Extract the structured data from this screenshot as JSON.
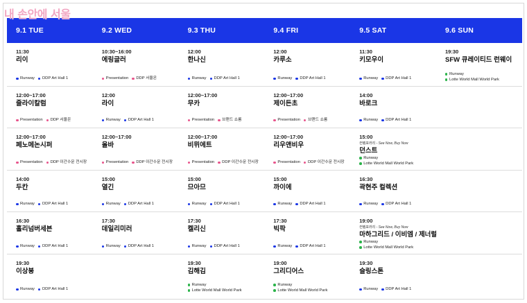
{
  "logo": {
    "text": "내 손안에 서울"
  },
  "colors": {
    "header_bg": "#1a36e6",
    "dot_runway": "#1a36e6",
    "dot_venue": "#1a36e6",
    "dot_presentation": "#e8548c",
    "dot_outdoor": "#2bb34a",
    "logo": "#f2a6c2"
  },
  "days": [
    {
      "label": "9.1 TUE"
    },
    {
      "label": "9.2 WED"
    },
    {
      "label": "9.3 THU"
    },
    {
      "label": "9.4 FRI"
    },
    {
      "label": "9.5 SAT"
    },
    {
      "label": "9.6 SUN"
    }
  ],
  "rows": [
    [
      {
        "time": "11:30",
        "title": "리이",
        "tags": [
          {
            "label": "Runway",
            "kind": "runway"
          },
          {
            "label": "DDP Art Hall 1",
            "kind": "venue"
          }
        ]
      },
      {
        "time": "10:30~16:00",
        "title": "에링글러",
        "tags": [
          {
            "label": "Presentation",
            "kind": "presentation"
          },
          {
            "label": "DDP 서울온",
            "kind": "presentation"
          }
        ]
      },
      {
        "time": "12:00",
        "title": "한나신",
        "tags": [
          {
            "label": "Runway",
            "kind": "runway"
          },
          {
            "label": "DDP Art Hall 1",
            "kind": "venue"
          }
        ]
      },
      {
        "time": "12:00",
        "title": "카루소",
        "tags": [
          {
            "label": "Runway",
            "kind": "runway"
          },
          {
            "label": "DDP Art Hall 1",
            "kind": "venue"
          }
        ]
      },
      {
        "time": "11:30",
        "title": "키모우이",
        "tags": [
          {
            "label": "Runway",
            "kind": "runway"
          },
          {
            "label": "DDP Art Hall 1",
            "kind": "venue"
          }
        ]
      },
      {
        "time": "19:30",
        "title": "SFW 큐레이티드 런웨이",
        "stack": true,
        "tags": [
          {
            "label": "Runway",
            "kind": "outdoor"
          },
          {
            "label": "Lotte World Mall World Park",
            "kind": "outdoor"
          }
        ]
      }
    ],
    [
      {
        "time": "12:00~17:00",
        "title": "줄라이칼럼",
        "tags": [
          {
            "label": "Presentation",
            "kind": "presentation"
          },
          {
            "label": "DDP 서울온",
            "kind": "presentation"
          }
        ]
      },
      {
        "time": "12:00",
        "title": "라이",
        "tags": [
          {
            "label": "Runway",
            "kind": "runway"
          },
          {
            "label": "DDP Art Hall 1",
            "kind": "venue"
          }
        ]
      },
      {
        "time": "12:00~17:00",
        "title": "무카",
        "tags": [
          {
            "label": "Presentation",
            "kind": "presentation"
          },
          {
            "label": "브랜드 쇼룸",
            "kind": "presentation"
          }
        ]
      },
      {
        "time": "12:00~17:00",
        "title": "제이든초",
        "tags": [
          {
            "label": "Presentation",
            "kind": "presentation"
          },
          {
            "label": "브랜드 쇼룸",
            "kind": "presentation"
          }
        ]
      },
      {
        "time": "14:00",
        "title": "바로크",
        "tags": [
          {
            "label": "Runway",
            "kind": "runway"
          },
          {
            "label": "DDP Art Hall 1",
            "kind": "venue"
          }
        ]
      },
      {
        "empty": true
      }
    ],
    [
      {
        "time": "12:00~17:00",
        "title": "페노메논시퍼",
        "tags": [
          {
            "label": "Presentation",
            "kind": "presentation"
          },
          {
            "label": "DDP 이간수문 전시장",
            "kind": "presentation"
          }
        ]
      },
      {
        "time": "12:00~17:00",
        "title": "올바",
        "tags": [
          {
            "label": "Presentation",
            "kind": "presentation"
          },
          {
            "label": "DDP 이간수문 전시장",
            "kind": "presentation"
          }
        ]
      },
      {
        "time": "12:00~17:00",
        "title": "비뮈에트",
        "tags": [
          {
            "label": "Presentation",
            "kind": "presentation"
          },
          {
            "label": "DDP 이간수문 전시장",
            "kind": "presentation"
          }
        ]
      },
      {
        "time": "12:00~17:00",
        "title": "리우앤비우",
        "tags": [
          {
            "label": "Presentation",
            "kind": "presentation"
          },
          {
            "label": "DDP 이간수문 전시장",
            "kind": "presentation"
          }
        ]
      },
      {
        "time": "15:00",
        "note_a": "컨템포러리",
        "note_b": " - See Now, Buy Now",
        "title": "던스트",
        "stack": true,
        "tags": [
          {
            "label": "Runway",
            "kind": "outdoor"
          },
          {
            "label": "Lotte World Mall World Park",
            "kind": "outdoor"
          }
        ]
      },
      {
        "empty": true
      }
    ],
    [
      {
        "time": "14:00",
        "title": "두칸",
        "tags": [
          {
            "label": "Runway",
            "kind": "runway"
          },
          {
            "label": "DDP Art Hall 1",
            "kind": "venue"
          }
        ]
      },
      {
        "time": "15:00",
        "title": "열긴",
        "tags": [
          {
            "label": "Runway",
            "kind": "runway"
          },
          {
            "label": "DDP Art Hall 1",
            "kind": "venue"
          }
        ]
      },
      {
        "time": "15:00",
        "title": "므아므",
        "tags": [
          {
            "label": "Runway",
            "kind": "runway"
          },
          {
            "label": "DDP Art Hall 1",
            "kind": "venue"
          }
        ]
      },
      {
        "time": "15:00",
        "title": "까이에",
        "tags": [
          {
            "label": "Runway",
            "kind": "runway"
          },
          {
            "label": "DDP Art Hall 1",
            "kind": "venue"
          }
        ]
      },
      {
        "time": "16:30",
        "title": "곽현주 컬렉션",
        "tags": [
          {
            "label": "Runway",
            "kind": "runway"
          },
          {
            "label": "DDP Art Hall 1",
            "kind": "venue"
          }
        ]
      },
      {
        "empty": true
      }
    ],
    [
      {
        "time": "16:30",
        "title": "홀리넘버세븐",
        "tags": [
          {
            "label": "Runway",
            "kind": "runway"
          },
          {
            "label": "DDP Art Hall 1",
            "kind": "venue"
          }
        ]
      },
      {
        "time": "17:30",
        "title": "데일리미러",
        "tags": [
          {
            "label": "Runway",
            "kind": "runway"
          },
          {
            "label": "DDP Art Hall 1",
            "kind": "venue"
          }
        ]
      },
      {
        "time": "17:30",
        "title": "켈리신",
        "tags": [
          {
            "label": "Runway",
            "kind": "runway"
          },
          {
            "label": "DDP Art Hall 1",
            "kind": "venue"
          }
        ]
      },
      {
        "time": "17:30",
        "title": "빅팍",
        "tags": [
          {
            "label": "Runway",
            "kind": "runway"
          },
          {
            "label": "DDP Art Hall 1",
            "kind": "venue"
          }
        ]
      },
      {
        "time": "19:00",
        "note_a": "컨템포러리",
        "note_b": " - See Now, Buy Now",
        "title": "마하그리드 / 이비엠 / 제너럴 아이디어",
        "stack": true,
        "tags": [
          {
            "label": "Runway",
            "kind": "outdoor"
          },
          {
            "label": "Lotte World Mall World Park",
            "kind": "outdoor"
          }
        ]
      },
      {
        "empty": true
      }
    ],
    [
      {
        "time": "19:30",
        "title": "이상봉",
        "tags": [
          {
            "label": "Runway",
            "kind": "runway"
          },
          {
            "label": "DDP Art Hall 1",
            "kind": "venue"
          }
        ]
      },
      {
        "empty": true
      },
      {
        "time": "19:30",
        "title": "김해김",
        "stack": true,
        "tags": [
          {
            "label": "Runway",
            "kind": "outdoor"
          },
          {
            "label": "Lotte World Mall World Park",
            "kind": "outdoor"
          }
        ]
      },
      {
        "time": "19:00",
        "title": "그리디어스",
        "stack": true,
        "tags": [
          {
            "label": "Runway",
            "kind": "outdoor"
          },
          {
            "label": "Lotte World Mall World Park",
            "kind": "outdoor"
          }
        ]
      },
      {
        "time": "19:30",
        "title": "슬링스톤",
        "tags": [
          {
            "label": "Runway",
            "kind": "runway"
          },
          {
            "label": "DDP Art Hall 1",
            "kind": "venue"
          }
        ]
      },
      {
        "empty": true
      }
    ]
  ]
}
